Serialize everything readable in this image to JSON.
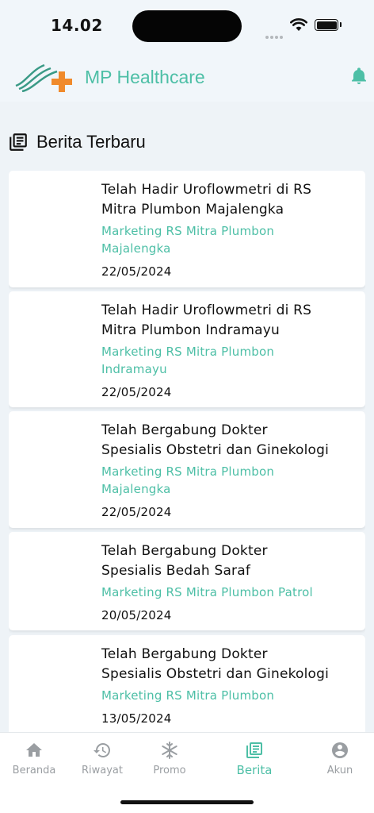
{
  "status_bar": {
    "time": "14.02"
  },
  "header": {
    "brand": "MP Healthcare",
    "colors": {
      "accent": "#4dbfa6",
      "logo_wave": "#3a9a86",
      "logo_cross": "#f08a2b"
    }
  },
  "section": {
    "title": "Berita Terbaru",
    "icon": "newspaper-icon"
  },
  "news": [
    {
      "title_line1": "Telah Hadir Uroflowmetri di RS",
      "title_line2": "Mitra Plumbon Majalengka",
      "author_line1": "Marketing RS Mitra Plumbon",
      "author_line2": "Majalengka",
      "date": "22/05/2024"
    },
    {
      "title_line1": "Telah Hadir Uroflowmetri di RS",
      "title_line2": "Mitra Plumbon Indramayu",
      "author_line1": "Marketing RS Mitra Plumbon",
      "author_line2": "Indramayu",
      "date": "22/05/2024"
    },
    {
      "title_line1": "Telah Bergabung Dokter",
      "title_line2": "Spesialis Obstetri dan Ginekologi",
      "author_line1": "Marketing RS Mitra Plumbon",
      "author_line2": "Majalengka",
      "date": "22/05/2024"
    },
    {
      "title_line1": "Telah Bergabung Dokter",
      "title_line2": "Spesialis Bedah Saraf",
      "author_line1": "Marketing RS Mitra Plumbon Patrol",
      "author_line2": "",
      "date": "20/05/2024"
    },
    {
      "title_line1": "Telah Bergabung Dokter",
      "title_line2": "Spesialis Obstetri dan Ginekologi",
      "author_line1": "Marketing RS Mitra Plumbon",
      "author_line2": "",
      "date": "13/05/2024"
    }
  ],
  "nav": [
    {
      "label": "Beranda",
      "icon": "home-icon"
    },
    {
      "label": "Riwayat",
      "icon": "history-icon"
    },
    {
      "label": "Promo",
      "icon": "snowflake-icon"
    },
    {
      "label": "Berita",
      "icon": "newspaper-icon",
      "active": true
    },
    {
      "label": "Akun",
      "icon": "account-icon"
    }
  ]
}
